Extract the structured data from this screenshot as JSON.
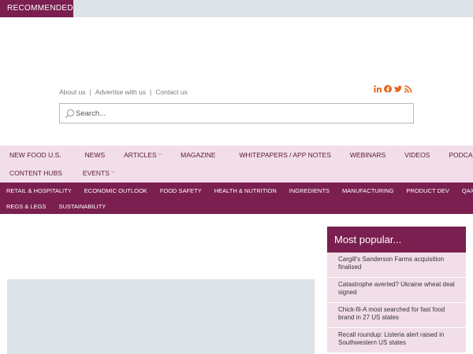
{
  "recommended": {
    "label": "RECOMMENDED"
  },
  "utility_links": [
    "About us",
    "Advertise with us",
    "Contact us"
  ],
  "social_icons": [
    "linkedin-icon",
    "facebook-icon",
    "twitter-icon",
    "rss-icon"
  ],
  "search": {
    "placeholder": "Search..."
  },
  "main_nav": {
    "row1": [
      "NEW FOOD U.S.",
      "NEWS",
      "ARTICLES",
      "MAGAZINE",
      "WHITEPAPERS / APP NOTES",
      "WEBINARS",
      "VIDEOS",
      "PODCASTS"
    ],
    "row2": [
      "CONTENT HUBS",
      "EVENTS"
    ]
  },
  "category_nav": {
    "row1": [
      "RETAIL & HOSPITALITY",
      "ECONOMIC OUTLOOK",
      "FOOD SAFETY",
      "HEALTH & NUTRITION",
      "INGREDIENTS",
      "MANUFACTURING",
      "PRODUCT DEV",
      "QA/QC"
    ],
    "row2": [
      "REGS & LEGS",
      "SUSTAINABILITY"
    ]
  },
  "most_popular": {
    "title": "Most popular...",
    "items": [
      "Cargill's Sanderson Farms acquisition finalised",
      "Catastrophe averted? Ukraine wheat deal signed",
      "Chick-fil-A most searched for fast food brand in 27 US states",
      "Recall roundup: Listeria alert raised in Southwestern US states"
    ]
  },
  "colors": {
    "brand": "#7a1f4f",
    "nav_bg": "#f2dee8",
    "placeholder_bg": "#dde2e6",
    "social_orange": "#e8641b"
  }
}
